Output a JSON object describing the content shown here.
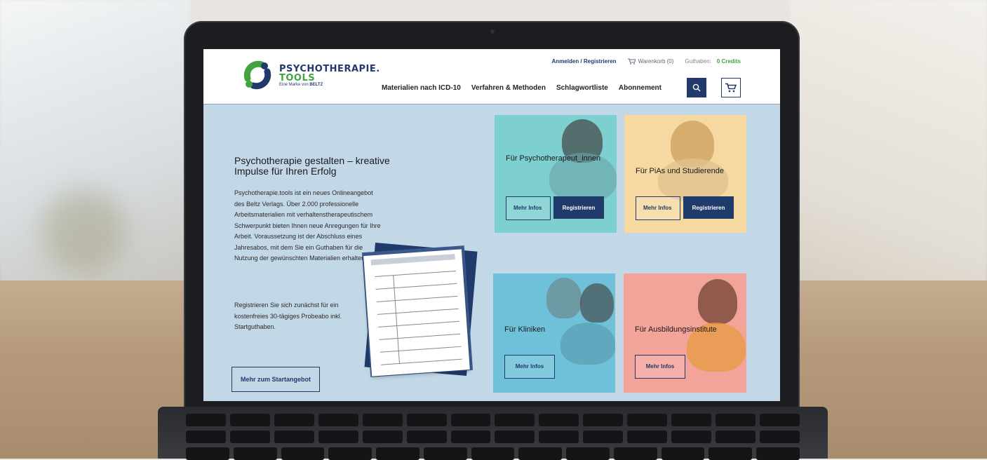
{
  "header": {
    "logo": {
      "title": "PSYCHOTHERAPIE.",
      "subtitle": "TOOLS",
      "tagline": "Eine Marke von",
      "publisher": "BELTZ"
    },
    "top_links": {
      "login_label": "Anmelden / Registrieren",
      "cart_label": "Warenkorb (0)",
      "balance_label": "Guthaben:",
      "balance_value": "0 Credits"
    },
    "nav": [
      {
        "label": "Materialien nach ICD-10"
      },
      {
        "label": "Verfahren & Methoden"
      },
      {
        "label": "Schlagwortliste"
      },
      {
        "label": "Abonnement"
      }
    ]
  },
  "hero": {
    "title": "Psychotherapie gestalten – kreative Impulse für Ihren Erfolg",
    "paragraph1": "Psychotherapie.tools ist ein neues Onlineangebot des Beltz Verlags. Über 2.000 professionelle Arbeitsmaterialien mit verhaltenstherapeutischem Schwerpunkt bieten Ihnen neue Anregungen für Ihre Arbeit. Voraussetzung ist der Abschluss eines Jahresabos, mit dem Sie ein Guthaben für die Nutzung der gewünschten Materialien erhalten.",
    "paragraph2": "Registrieren Sie sich zunächst für ein kostenfreies 30-tägiges Probeabo inkl. Startguthaben.",
    "cta_label": "Mehr zum Startangebot"
  },
  "tiles": [
    {
      "title": "Für Psychotherapeut_innen",
      "info_label": "Mehr Infos",
      "register_label": "Registrieren",
      "color": "#7ecfd0"
    },
    {
      "title": "Für PiAs und Studierende",
      "info_label": "Mehr Infos",
      "register_label": "Registrieren",
      "color": "#f5d9a1"
    },
    {
      "title": "Für Kliniken",
      "info_label": "Mehr Infos",
      "color": "#6fc1d9"
    },
    {
      "title": "Für Ausbildungsinstitute",
      "info_label": "Mehr Infos",
      "color": "#f2a39a"
    }
  ],
  "icons": {
    "search": "search-icon",
    "cart": "cart-icon"
  }
}
